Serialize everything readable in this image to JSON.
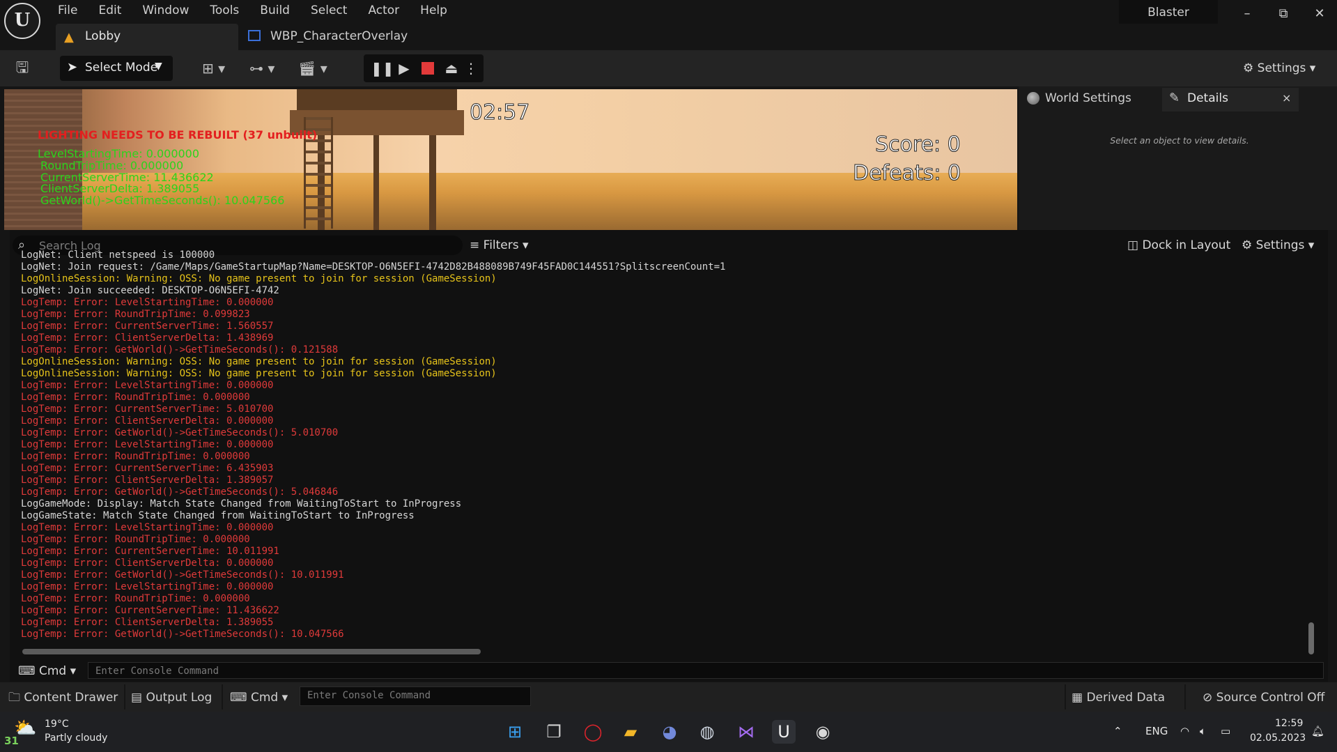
{
  "menu": [
    "File",
    "Edit",
    "Window",
    "Tools",
    "Build",
    "Select",
    "Actor",
    "Help"
  ],
  "window": {
    "project": "Blaster",
    "min": "–",
    "max": "⧉",
    "close": "✕"
  },
  "tabs": [
    {
      "label": "Lobby"
    },
    {
      "label": "WBP_CharacterOverlay"
    }
  ],
  "toolbar": {
    "select_mode": "Select Mode",
    "settings": "Settings"
  },
  "viewport": {
    "timer": "02:57",
    "score": "Score: 0",
    "defeats": "Defeats: 0",
    "warning": "LIGHTING NEEDS TO BE REBUILT (37 unbuilt)",
    "debug": [
      "LevelStartingTime: 0.000000",
      "RoundTripTime: 0.000000",
      "CurrentServerTime: 11.436622",
      "ClientServerDelta: 1.389055",
      "GetWorld()->GetTimeSeconds(): 10.047566"
    ]
  },
  "right_panel": {
    "world_settings": "World Settings",
    "details": "Details",
    "close": "×",
    "empty": "Select an object to view details."
  },
  "log": {
    "search_placeholder": "Search Log",
    "filters": "Filters",
    "dock": "Dock in Layout",
    "settings": "Settings",
    "lines": [
      {
        "t": "normal",
        "text": "LogNet: Client netspeed is 100000"
      },
      {
        "t": "normal",
        "text": "LogNet: Join request: /Game/Maps/GameStartupMap?Name=DESKTOP-O6N5EFI-4742D82B488089B749F45FAD0C144551?SplitscreenCount=1"
      },
      {
        "t": "warning",
        "text": "LogOnlineSession: Warning: OSS: No game present to join for session (GameSession)"
      },
      {
        "t": "normal",
        "text": "LogNet: Join succeeded: DESKTOP-O6N5EFI-4742"
      },
      {
        "t": "error",
        "text": "LogTemp: Error: LevelStartingTime: 0.000000"
      },
      {
        "t": "error",
        "text": "LogTemp: Error: RoundTripTime: 0.099823"
      },
      {
        "t": "error",
        "text": "LogTemp: Error: CurrentServerTime: 1.560557"
      },
      {
        "t": "error",
        "text": "LogTemp: Error: ClientServerDelta: 1.438969"
      },
      {
        "t": "error",
        "text": "LogTemp: Error: GetWorld()->GetTimeSeconds(): 0.121588"
      },
      {
        "t": "warning",
        "text": "LogOnlineSession: Warning: OSS: No game present to join for session (GameSession)"
      },
      {
        "t": "warning",
        "text": "LogOnlineSession: Warning: OSS: No game present to join for session (GameSession)"
      },
      {
        "t": "error",
        "text": "LogTemp: Error: LevelStartingTime: 0.000000"
      },
      {
        "t": "error",
        "text": "LogTemp: Error: RoundTripTime: 0.000000"
      },
      {
        "t": "error",
        "text": "LogTemp: Error: CurrentServerTime: 5.010700"
      },
      {
        "t": "error",
        "text": "LogTemp: Error: ClientServerDelta: 0.000000"
      },
      {
        "t": "error",
        "text": "LogTemp: Error: GetWorld()->GetTimeSeconds(): 5.010700"
      },
      {
        "t": "error",
        "text": "LogTemp: Error: LevelStartingTime: 0.000000"
      },
      {
        "t": "error",
        "text": "LogTemp: Error: RoundTripTime: 0.000000"
      },
      {
        "t": "error",
        "text": "LogTemp: Error: CurrentServerTime: 6.435903"
      },
      {
        "t": "error",
        "text": "LogTemp: Error: ClientServerDelta: 1.389057"
      },
      {
        "t": "error",
        "text": "LogTemp: Error: GetWorld()->GetTimeSeconds(): 5.046846"
      },
      {
        "t": "normal",
        "text": "LogGameMode: Display: Match State Changed from WaitingToStart to InProgress"
      },
      {
        "t": "normal",
        "text": "LogGameState: Match State Changed from WaitingToStart to InProgress"
      },
      {
        "t": "error",
        "text": "LogTemp: Error: LevelStartingTime: 0.000000"
      },
      {
        "t": "error",
        "text": "LogTemp: Error: RoundTripTime: 0.000000"
      },
      {
        "t": "error",
        "text": "LogTemp: Error: CurrentServerTime: 10.011991"
      },
      {
        "t": "error",
        "text": "LogTemp: Error: ClientServerDelta: 0.000000"
      },
      {
        "t": "error",
        "text": "LogTemp: Error: GetWorld()->GetTimeSeconds(): 10.011991"
      },
      {
        "t": "error",
        "text": "LogTemp: Error: LevelStartingTime: 0.000000"
      },
      {
        "t": "error",
        "text": "LogTemp: Error: RoundTripTime: 0.000000"
      },
      {
        "t": "error",
        "text": "LogTemp: Error: CurrentServerTime: 11.436622"
      },
      {
        "t": "error",
        "text": "LogTemp: Error: ClientServerDelta: 1.389055"
      },
      {
        "t": "error",
        "text": "LogTemp: Error: GetWorld()->GetTimeSeconds(): 10.047566"
      }
    ],
    "cmd_label": "Cmd",
    "cmd_placeholder": "Enter Console Command"
  },
  "statusbar": {
    "content_drawer": "Content Drawer",
    "output_log": "Output Log",
    "cmd": "Cmd",
    "cmd_placeholder": "Enter Console Command",
    "derived_data": "Derived Data",
    "source_control": "Source Control Off"
  },
  "taskbar": {
    "weather_temp": "19°C",
    "weather_desc": "Partly cloudy",
    "weather_badge": "31",
    "lang": "ENG",
    "time": "12:59",
    "date": "02.05.2023"
  },
  "colors": {
    "error": "#e03a3a",
    "warning": "#e6c31a",
    "normal": "#d6d6d6",
    "accent": "#3a6fd8"
  }
}
